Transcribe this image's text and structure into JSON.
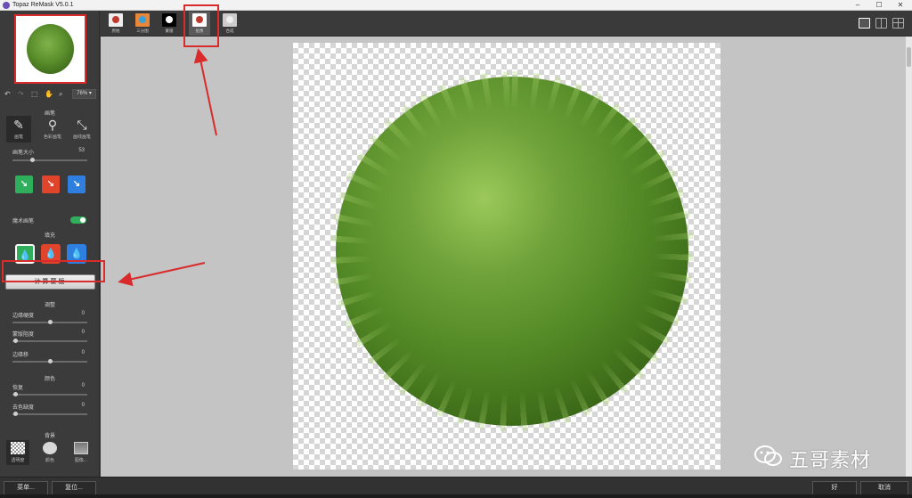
{
  "window": {
    "title": "Topaz ReMask V5.0.1",
    "controls": [
      "–",
      "☐",
      "✕"
    ]
  },
  "toolbar": {
    "zoom": "76%",
    "mask_tools": [
      {
        "label": "原始",
        "icon": "apple-red-icon",
        "color": "#c0392b"
      },
      {
        "label": "三分图",
        "icon": "trimap-icon",
        "color": "#3aa1d8"
      },
      {
        "label": "蒙版",
        "icon": "mask-icon",
        "color": "#000000"
      },
      {
        "label": "抠像",
        "icon": "cutout-icon",
        "color": "#c0392b"
      },
      {
        "label": "合成",
        "icon": "composite-icon",
        "color": "#dddddd"
      }
    ]
  },
  "left_panel": {
    "brush_section": "画笔",
    "brushes": [
      {
        "label": "画笔",
        "icon": "brush-icon"
      },
      {
        "label": "色彩画笔",
        "icon": "color-brush-icon"
      },
      {
        "label": "画线画笔",
        "icon": "line-brush-icon"
      }
    ],
    "brush_size_label": "画笔大小",
    "brush_size_value": "53",
    "brush_modes": [
      {
        "icon": "keep-brush-icon",
        "color": "#2fae5c"
      },
      {
        "icon": "remove-brush-icon",
        "color": "#e0452b"
      },
      {
        "icon": "compute-brush-icon",
        "color": "#2f7fe0"
      }
    ],
    "magic_brush_label": "魔术画笔",
    "fill_section": "填充",
    "fill_modes": [
      {
        "icon": "keep-fill-icon",
        "color": "#2fae5c"
      },
      {
        "icon": "remove-fill-icon",
        "color": "#e0452b"
      },
      {
        "icon": "compute-fill-icon",
        "color": "#2f7fe0"
      }
    ],
    "compute_button": "计算蒙版",
    "adjust_section": "调整",
    "adjust_rows": [
      {
        "label": "边缘硬度",
        "value": "0"
      },
      {
        "label": "蒙版阻度",
        "value": "0"
      },
      {
        "label": "边缘移",
        "value": "0"
      }
    ],
    "color_section": "颜色",
    "color_rows": [
      {
        "label": "恢复",
        "value": "0"
      },
      {
        "label": "去色缺度",
        "value": "0"
      }
    ],
    "background_section": "背景",
    "background_options": [
      {
        "label": "透明度",
        "icon": "transparency-icon"
      },
      {
        "label": "颜色",
        "icon": "palette-icon"
      },
      {
        "label": "图像...",
        "icon": "image-icon"
      }
    ]
  },
  "bottom": {
    "menu_button": "菜单...",
    "reset_button": "复位...",
    "ok_button": "好",
    "cancel_button": "取消"
  },
  "watermark": {
    "text": "五哥素材"
  },
  "annotation_color": "#d92b2b"
}
